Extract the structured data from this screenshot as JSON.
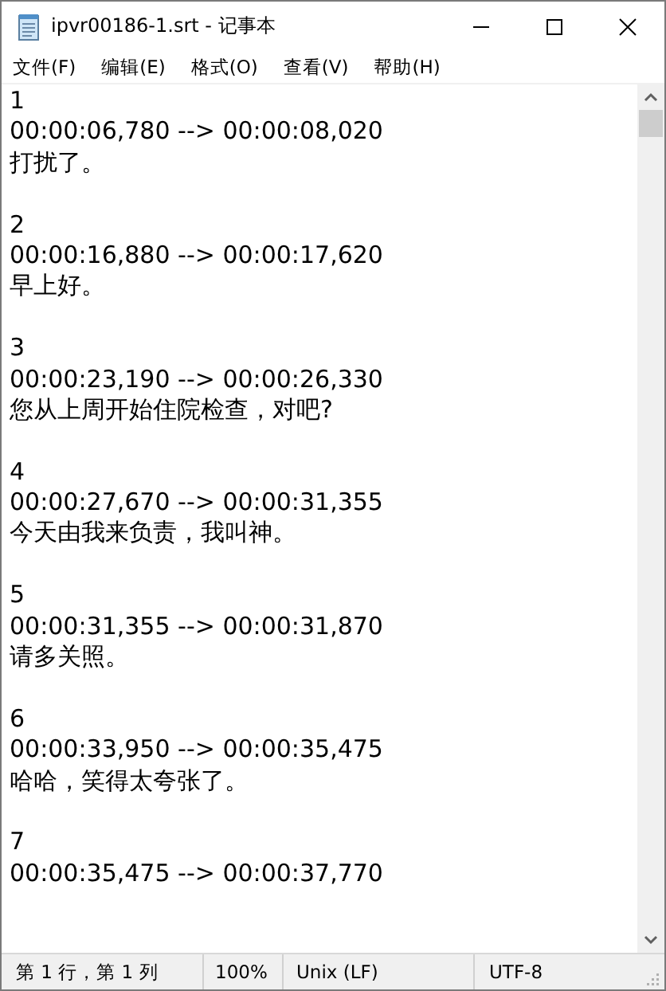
{
  "window": {
    "title": "ipvr00186-1.srt - 记事本"
  },
  "menu": [
    "文件(F)",
    "编辑(E)",
    "格式(O)",
    "查看(V)",
    "帮助(H)"
  ],
  "subtitles": [
    {
      "index": "1",
      "time": "00:00:06,780 --> 00:00:08,020",
      "text": "打扰了。"
    },
    {
      "index": "2",
      "time": "00:00:16,880 --> 00:00:17,620",
      "text": "早上好。"
    },
    {
      "index": "3",
      "time": "00:00:23,190 --> 00:00:26,330",
      "text": "您从上周开始住院检查，对吧?"
    },
    {
      "index": "4",
      "time": "00:00:27,670 --> 00:00:31,355",
      "text": "今天由我来负责，我叫神。"
    },
    {
      "index": "5",
      "time": "00:00:31,355 --> 00:00:31,870",
      "text": "请多关照。"
    },
    {
      "index": "6",
      "time": "00:00:33,950 --> 00:00:35,475",
      "text": "哈哈，笑得太夸张了。"
    },
    {
      "index": "7",
      "time": "00:00:35,475 --> 00:00:37,770"
    }
  ],
  "status_bar": [
    "第 1 行，第 1 列",
    "100%",
    "Unix (LF)",
    "UTF-8"
  ]
}
